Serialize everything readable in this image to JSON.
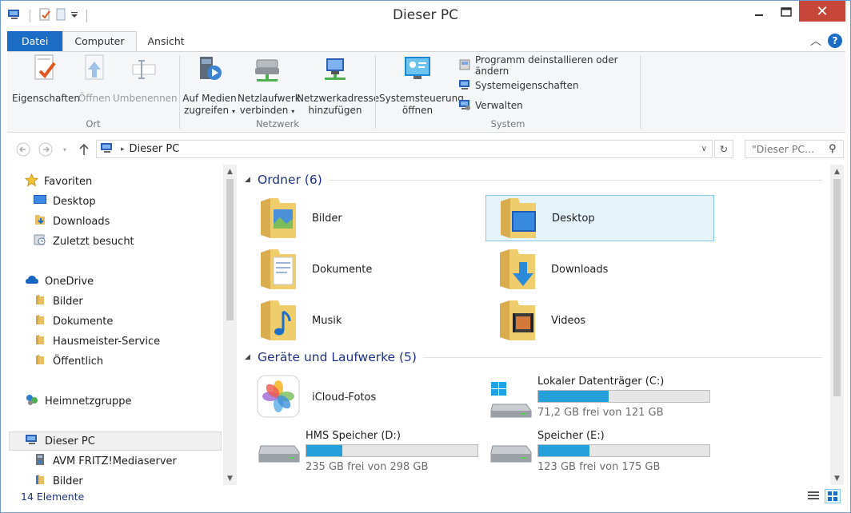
{
  "window": {
    "title": "Dieser PC"
  },
  "ribbon": {
    "tabs": [
      {
        "label": "Datei"
      },
      {
        "label": "Computer"
      },
      {
        "label": "Ansicht"
      }
    ],
    "groups": {
      "ort": {
        "label": "Ort",
        "buttons": [
          {
            "label": "Eigenschaften",
            "icon": "properties-icon",
            "enabled": true
          },
          {
            "label": "Öffnen",
            "icon": "open-icon",
            "enabled": false
          },
          {
            "label": "Umbenennen",
            "icon": "rename-icon",
            "enabled": false
          }
        ]
      },
      "netzwerk": {
        "label": "Netzwerk",
        "buttons": [
          {
            "line1": "Auf Medien",
            "line2": "zugreifen",
            "icon": "media-access-icon",
            "dropdown": true
          },
          {
            "line1": "Netzlaufwerk",
            "line2": "verbinden",
            "icon": "network-drive-icon",
            "dropdown": true
          },
          {
            "line1": "Netzwerkadresse",
            "line2": "hinzufügen",
            "icon": "network-location-icon",
            "dropdown": false
          }
        ]
      },
      "system": {
        "label": "System",
        "big": {
          "line1": "Systemsteuerung",
          "line2": "öffnen",
          "icon": "control-panel-icon"
        },
        "small": [
          {
            "label": "Programm deinstallieren oder ändern",
            "icon": "uninstall-icon"
          },
          {
            "label": "Systemeigenschaften",
            "icon": "system-properties-icon"
          },
          {
            "label": "Verwalten",
            "icon": "manage-icon"
          }
        ]
      }
    }
  },
  "address": {
    "path": "Dieser PC",
    "search_placeholder": "\"Dieser PC...",
    "separator": "▸"
  },
  "nav": {
    "items": [
      {
        "label": "Favoriten",
        "icon": "star-icon",
        "level": 0
      },
      {
        "label": "Desktop",
        "icon": "desktop-icon",
        "level": 1
      },
      {
        "label": "Downloads",
        "icon": "downloads-icon",
        "level": 1
      },
      {
        "label": "Zuletzt besucht",
        "icon": "recent-icon",
        "level": 1
      },
      {
        "label": "OneDrive",
        "icon": "onedrive-icon",
        "level": 0
      },
      {
        "label": "Bilder",
        "icon": "folder-icon",
        "level": 1
      },
      {
        "label": "Dokumente",
        "icon": "folder-icon",
        "level": 1
      },
      {
        "label": "Hausmeister-Service",
        "icon": "folder-icon",
        "level": 1
      },
      {
        "label": "Öffentlich",
        "icon": "folder-icon",
        "level": 1
      },
      {
        "label": "Heimnetzgruppe",
        "icon": "homegroup-icon",
        "level": 0
      },
      {
        "label": "Dieser PC",
        "icon": "computer-icon",
        "level": 0,
        "selected": true
      },
      {
        "label": "AVM FRITZ!Mediaserver",
        "icon": "mediaserver-icon",
        "level": 1
      },
      {
        "label": "Bilder",
        "icon": "pictures-icon",
        "level": 1
      }
    ]
  },
  "content": {
    "folders_header": "Ordner (6)",
    "folders": [
      {
        "name": "Bilder",
        "icon": "pictures-folder-icon"
      },
      {
        "name": "Desktop",
        "icon": "desktop-folder-icon",
        "selected": true
      },
      {
        "name": "Dokumente",
        "icon": "documents-folder-icon"
      },
      {
        "name": "Downloads",
        "icon": "downloads-folder-icon"
      },
      {
        "name": "Musik",
        "icon": "music-folder-icon"
      },
      {
        "name": "Videos",
        "icon": "videos-folder-icon"
      }
    ],
    "devices_header": "Geräte und Laufwerke (5)",
    "devices": [
      {
        "name": "iCloud-Fotos",
        "icon": "icloud-photos-icon"
      },
      {
        "name": "Lokaler Datenträger (C:)",
        "free": "71,2 GB frei von 121 GB",
        "used_fraction": 0.41,
        "icon": "windows-drive-icon"
      },
      {
        "name": "HMS Speicher (D:)",
        "free": "235 GB frei von 298 GB",
        "used_fraction": 0.21,
        "icon": "hard-drive-icon"
      },
      {
        "name": "Speicher (E:)",
        "free": "123 GB frei von 175 GB",
        "used_fraction": 0.3,
        "icon": "hard-drive-icon"
      }
    ]
  },
  "status": {
    "count": "14 Elemente"
  },
  "colors": {
    "accent": "#1b6cc4",
    "selection": "#e5f3fb",
    "progress": "#26a0da",
    "close": "#c7463a"
  }
}
